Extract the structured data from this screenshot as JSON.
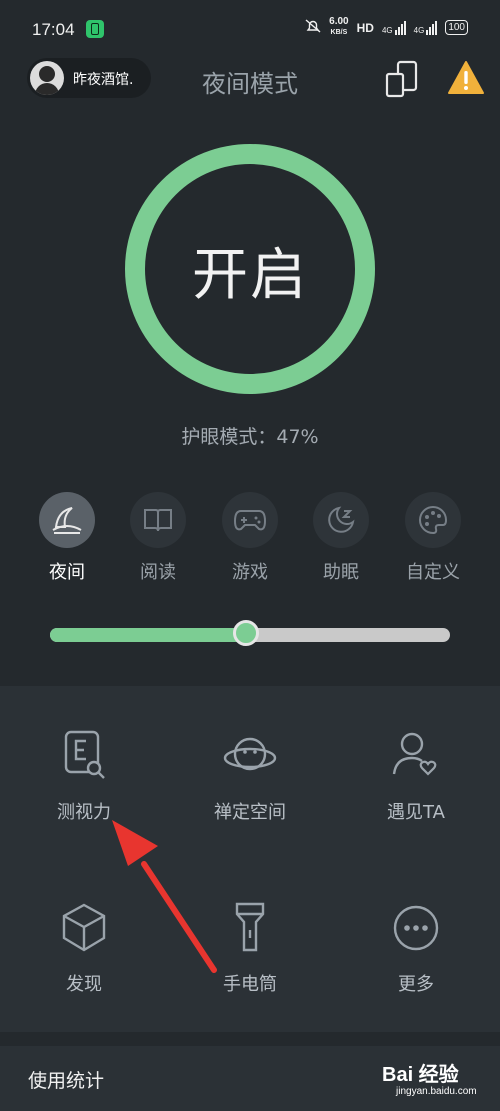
{
  "status_bar": {
    "time": "17:04",
    "net_speed_value": "6.00",
    "net_speed_unit": "KB/S",
    "hd": "HD",
    "net1": "4G",
    "net2": "4G",
    "battery": "100"
  },
  "header": {
    "username": "昨夜酒馆.",
    "title": "夜间模式"
  },
  "ring": {
    "label": "开启",
    "color": "#7ccd93"
  },
  "eye_mode": "护眼模式：47%",
  "modes": [
    {
      "label": "夜间",
      "icon": "moon-icon",
      "active": true
    },
    {
      "label": "阅读",
      "icon": "book-icon",
      "active": false
    },
    {
      "label": "游戏",
      "icon": "gamepad-icon",
      "active": false
    },
    {
      "label": "助眠",
      "icon": "sleep-moon-icon",
      "active": false
    },
    {
      "label": "自定义",
      "icon": "palette-icon",
      "active": false
    }
  ],
  "slider": {
    "value": 0.49
  },
  "tools": [
    {
      "label": "测视力",
      "icon": "eye-test-icon"
    },
    {
      "label": "禅定空间",
      "icon": "planet-icon"
    },
    {
      "label": "遇见TA",
      "icon": "person-heart-icon"
    },
    {
      "label": "发现",
      "icon": "cube-icon"
    },
    {
      "label": "手电筒",
      "icon": "flashlight-icon"
    },
    {
      "label": "更多",
      "icon": "more-icon"
    }
  ],
  "stats": {
    "label": "使用统计"
  },
  "watermark": {
    "text": "Bai 经验",
    "url": "jingyan.baidu.com"
  },
  "colors": {
    "accent": "#7ccd93",
    "background": "#24292d",
    "arrow": "#e8352f"
  }
}
